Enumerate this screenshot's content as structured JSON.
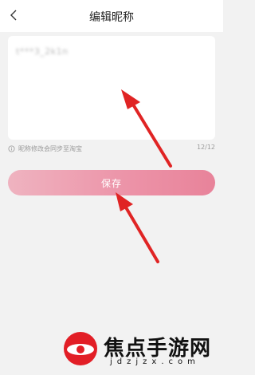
{
  "header": {
    "title": "编辑昵称",
    "back_icon": "chevron-left-icon"
  },
  "nickname": {
    "value": "t***3_2k1n"
  },
  "hint": {
    "text": "昵称修改会同步至淘宝",
    "icon": "info-circle-icon"
  },
  "counter": {
    "text": "12/12"
  },
  "save_button": {
    "label": "保存"
  },
  "watermark": {
    "name": "焦点手游网",
    "domain": "jdzjzx.com"
  },
  "colors": {
    "accent": "#e98aa0",
    "annotation": "#e02424"
  }
}
